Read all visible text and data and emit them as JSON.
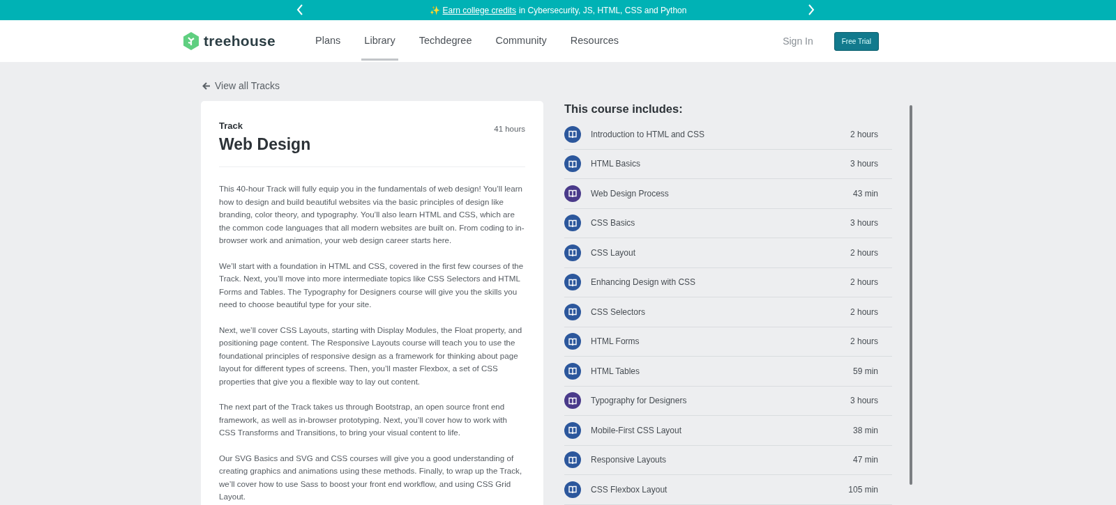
{
  "promo_bar": {
    "sparkle": "✨",
    "link": "Earn college credits",
    "text": "in Cybersecurity, JS, HTML, CSS and Python"
  },
  "nav": {
    "logo": "treehouse",
    "items": [
      {
        "label": "Plans",
        "selected": false
      },
      {
        "label": "Library",
        "selected": true
      },
      {
        "label": "Techdegree",
        "selected": false
      },
      {
        "label": "Community",
        "selected": false
      },
      {
        "label": "Resources",
        "selected": false
      }
    ],
    "sign_in": "Sign In",
    "free_trial": "Free Trial"
  },
  "back_link": "View all Tracks",
  "track": {
    "kind": "Track",
    "duration": "41 hours",
    "title": "Web Design",
    "paragraphs": [
      "This 40-hour Track will fully equip you in the fundamentals of web design! You’ll learn how to design and build beautiful websites via the basic principles of design like branding, color theory, and typography. You’ll also learn HTML and CSS, which are the common code languages that all modern websites are built on. From coding to in-browser work and animation, your web design career starts here.",
      "We’ll start with a foundation in HTML and CSS, covered in the first few courses of the Track. Next, you’ll move into more intermediate topics like CSS Selectors and HTML Forms and Tables. The Typography for Designers course will give you the skills you need to choose beautiful type for your site.",
      "Next, we’ll cover CSS Layouts, starting with Display Modules, the Float property, and positioning page content. The Responsive Layouts course will teach you to use the foundational principles of responsive design as a framework for thinking about page layout for different types of screens. Then, you’ll master Flexbox, a set of CSS properties that give you a flexible way to lay out content.",
      "The next part of the Track takes us through Bootstrap, an open source front end framework, as well as in-browser prototyping. Next, you’ll cover how to work with CSS Transforms and Transitions, to bring your visual content to life.",
      "Our SVG Basics and SVG and CSS courses will give you a good understanding of creating graphics and animations using these methods. Finally, to wrap up the Track, we’ll cover how to use Sass to boost your front end workflow, and using CSS Grid Layout."
    ]
  },
  "includes": {
    "title": "This course includes:",
    "courses": [
      {
        "name": "Introduction to HTML and CSS",
        "duration": "2 hours",
        "color": "#2c579c"
      },
      {
        "name": "HTML Basics",
        "duration": "3 hours",
        "color": "#2c579c"
      },
      {
        "name": "Web Design Process",
        "duration": "43 min",
        "color": "#4a3a8a"
      },
      {
        "name": "CSS Basics",
        "duration": "3 hours",
        "color": "#2c579c"
      },
      {
        "name": "CSS Layout",
        "duration": "2 hours",
        "color": "#2c579c"
      },
      {
        "name": "Enhancing Design with CSS",
        "duration": "2 hours",
        "color": "#2c579c"
      },
      {
        "name": "CSS Selectors",
        "duration": "2 hours",
        "color": "#2c579c"
      },
      {
        "name": "HTML Forms",
        "duration": "2 hours",
        "color": "#2c579c"
      },
      {
        "name": "HTML Tables",
        "duration": "59 min",
        "color": "#2c579c"
      },
      {
        "name": "Typography for Designers",
        "duration": "3 hours",
        "color": "#4a3a8a"
      },
      {
        "name": "Mobile-First CSS Layout",
        "duration": "38 min",
        "color": "#2c579c"
      },
      {
        "name": "Responsive Layouts",
        "duration": "47 min",
        "color": "#2c579c"
      },
      {
        "name": "CSS Flexbox Layout",
        "duration": "105 min",
        "color": "#2c579c"
      }
    ]
  }
}
